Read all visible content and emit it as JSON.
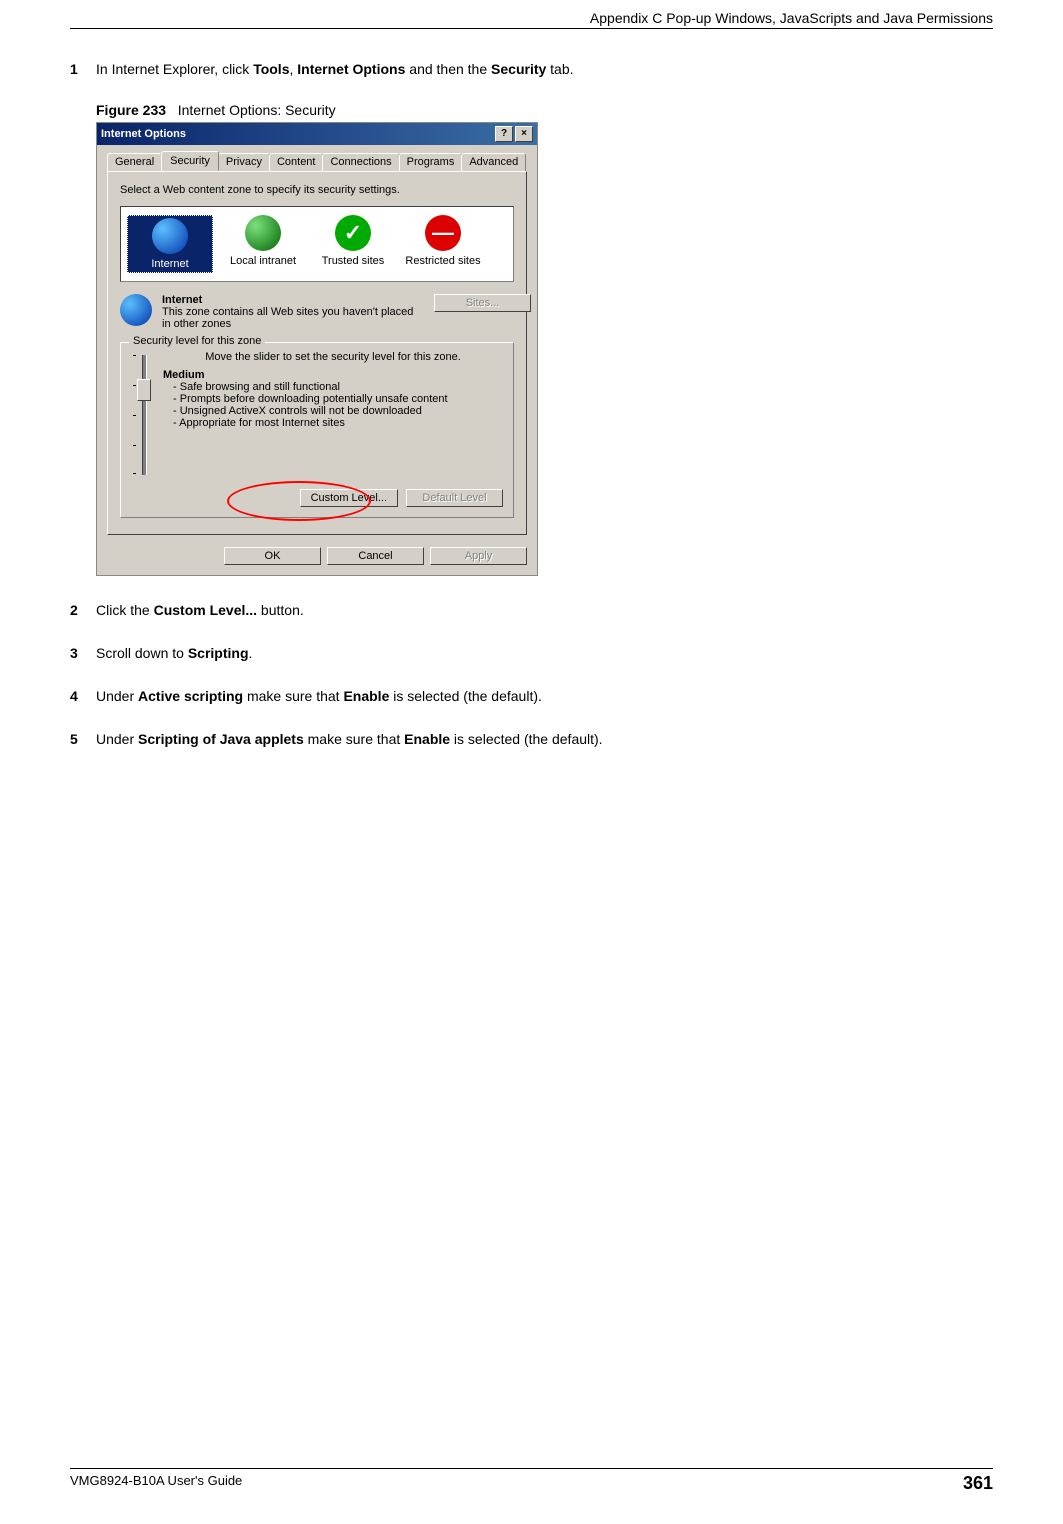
{
  "header": {
    "text": "Appendix C Pop-up Windows, JavaScripts and Java Permissions"
  },
  "steps": [
    {
      "num": "1",
      "parts": [
        "In Internet Explorer, click ",
        "Tools",
        ", ",
        "Internet Options",
        " and then the ",
        "Security",
        " tab."
      ]
    },
    {
      "num": "2",
      "parts": [
        "Click the ",
        "Custom Level...",
        " button."
      ]
    },
    {
      "num": "3",
      "parts": [
        "Scroll down to ",
        "Scripting",
        "."
      ]
    },
    {
      "num": "4",
      "parts": [
        "Under ",
        "Active scripting",
        " make sure that ",
        "Enable",
        " is selected (the default)."
      ]
    },
    {
      "num": "5",
      "parts": [
        "Under ",
        "Scripting of Java applets",
        " make sure that ",
        "Enable",
        " is selected (the default)."
      ]
    }
  ],
  "figure": {
    "label": "Figure 233",
    "caption": "Internet Options: Security"
  },
  "dialog": {
    "title": "Internet Options",
    "help_btn": "?",
    "close_btn": "×",
    "tabs": [
      "General",
      "Security",
      "Privacy",
      "Content",
      "Connections",
      "Programs",
      "Advanced"
    ],
    "active_tab": "Security",
    "instruction": "Select a Web content zone to specify its security settings.",
    "zones": [
      {
        "label": "Internet",
        "selected": true,
        "icon": "globe"
      },
      {
        "label": "Local intranet",
        "selected": false,
        "icon": "intranet"
      },
      {
        "label": "Trusted sites",
        "selected": false,
        "icon": "trusted"
      },
      {
        "label": "Restricted sites",
        "selected": false,
        "icon": "restricted"
      }
    ],
    "zone_detail": {
      "title": "Internet",
      "desc": "This zone contains all Web sites you haven't placed in other zones"
    },
    "sites_btn": "Sites...",
    "groupbox_legend": "Security level for this zone",
    "slider_instruction": "Move the slider to set the security level for this zone.",
    "level_name": "Medium",
    "level_bullets": [
      "Safe browsing and still functional",
      "Prompts before downloading potentially unsafe content",
      "Unsigned ActiveX controls will not be downloaded",
      "Appropriate for most Internet sites"
    ],
    "custom_level_btn": "Custom Level...",
    "default_level_btn": "Default Level",
    "ok_btn": "OK",
    "cancel_btn": "Cancel",
    "apply_btn": "Apply"
  },
  "footer": {
    "guide": "VMG8924-B10A User's Guide",
    "page": "361"
  }
}
